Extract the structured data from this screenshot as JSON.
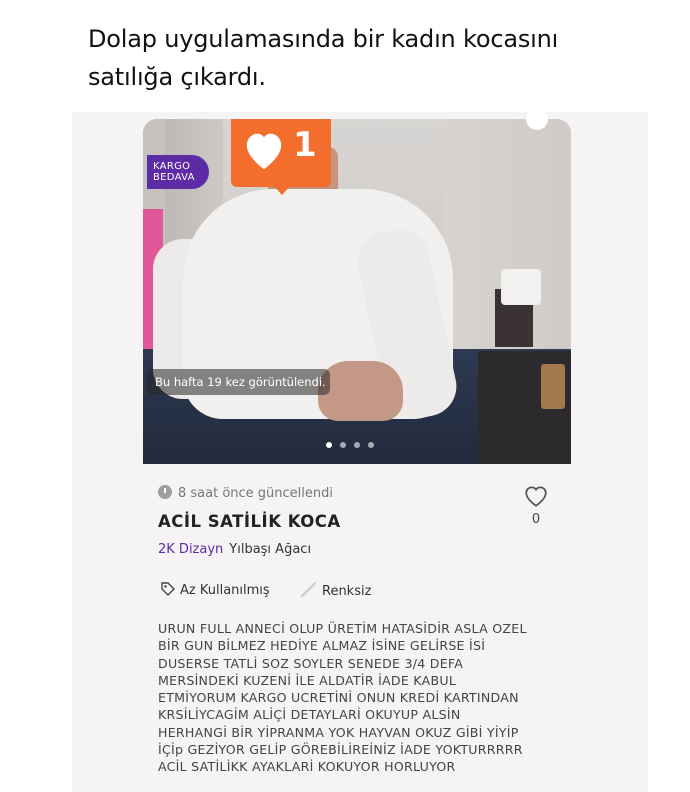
{
  "caption": "Dolap uygulamasında bir kadın kocasını satılığa çıkardı.",
  "listing": {
    "badge_shipping": "KARGO\nBEDAVA",
    "like_count": "1",
    "views_text": "Bu hafta 19 kez görüntülendi.",
    "carousel": {
      "total": 4,
      "active": 0
    },
    "updated": "8 saat önce güncellendi",
    "title": "ACİL SATİLİK KOCA",
    "favorite_count": "0",
    "brand": "2K Dizayn",
    "category": "Yılbaşı Ağacı",
    "condition": "Az Kullanılmış",
    "color": "Renksiz",
    "description": "URUN FULL ANNECİ OLUP ÜRETİM HATASİDİR ASLA OZEL\nBİR GUN BİLMEZ HEDİYE ALMAZ İSİNE GELİRSE İSİ\nDUSERSE TATLİ SOZ SOYLER SENEDE 3/4 DEFA\nMERSİNDEKİ KUZENİ İLE ALDATİR İADE KABUL\nETMİYORUM KARGO UCRETİNİ ONUN KREDİ KARTINDAN\nKRSİLİYCAGİM ALİÇİ DETAYLARİ OKUYUP ALSİN\nHERHANGİ BİR YİPRANMA YOK HAYVAN OKUZ GİBİ YİYİP\nİÇİp GEZİYOR GELİP GÖREBİLİREİNİZ İADE YOKTURRRRR\nACİL SATİLİKK AYAKLARİ KOKUYOR HORLUYOR"
  },
  "colors": {
    "brand_purple": "#5e2ba6",
    "like_orange": "#f36d2c",
    "card_bg": "#f5f3f4"
  }
}
